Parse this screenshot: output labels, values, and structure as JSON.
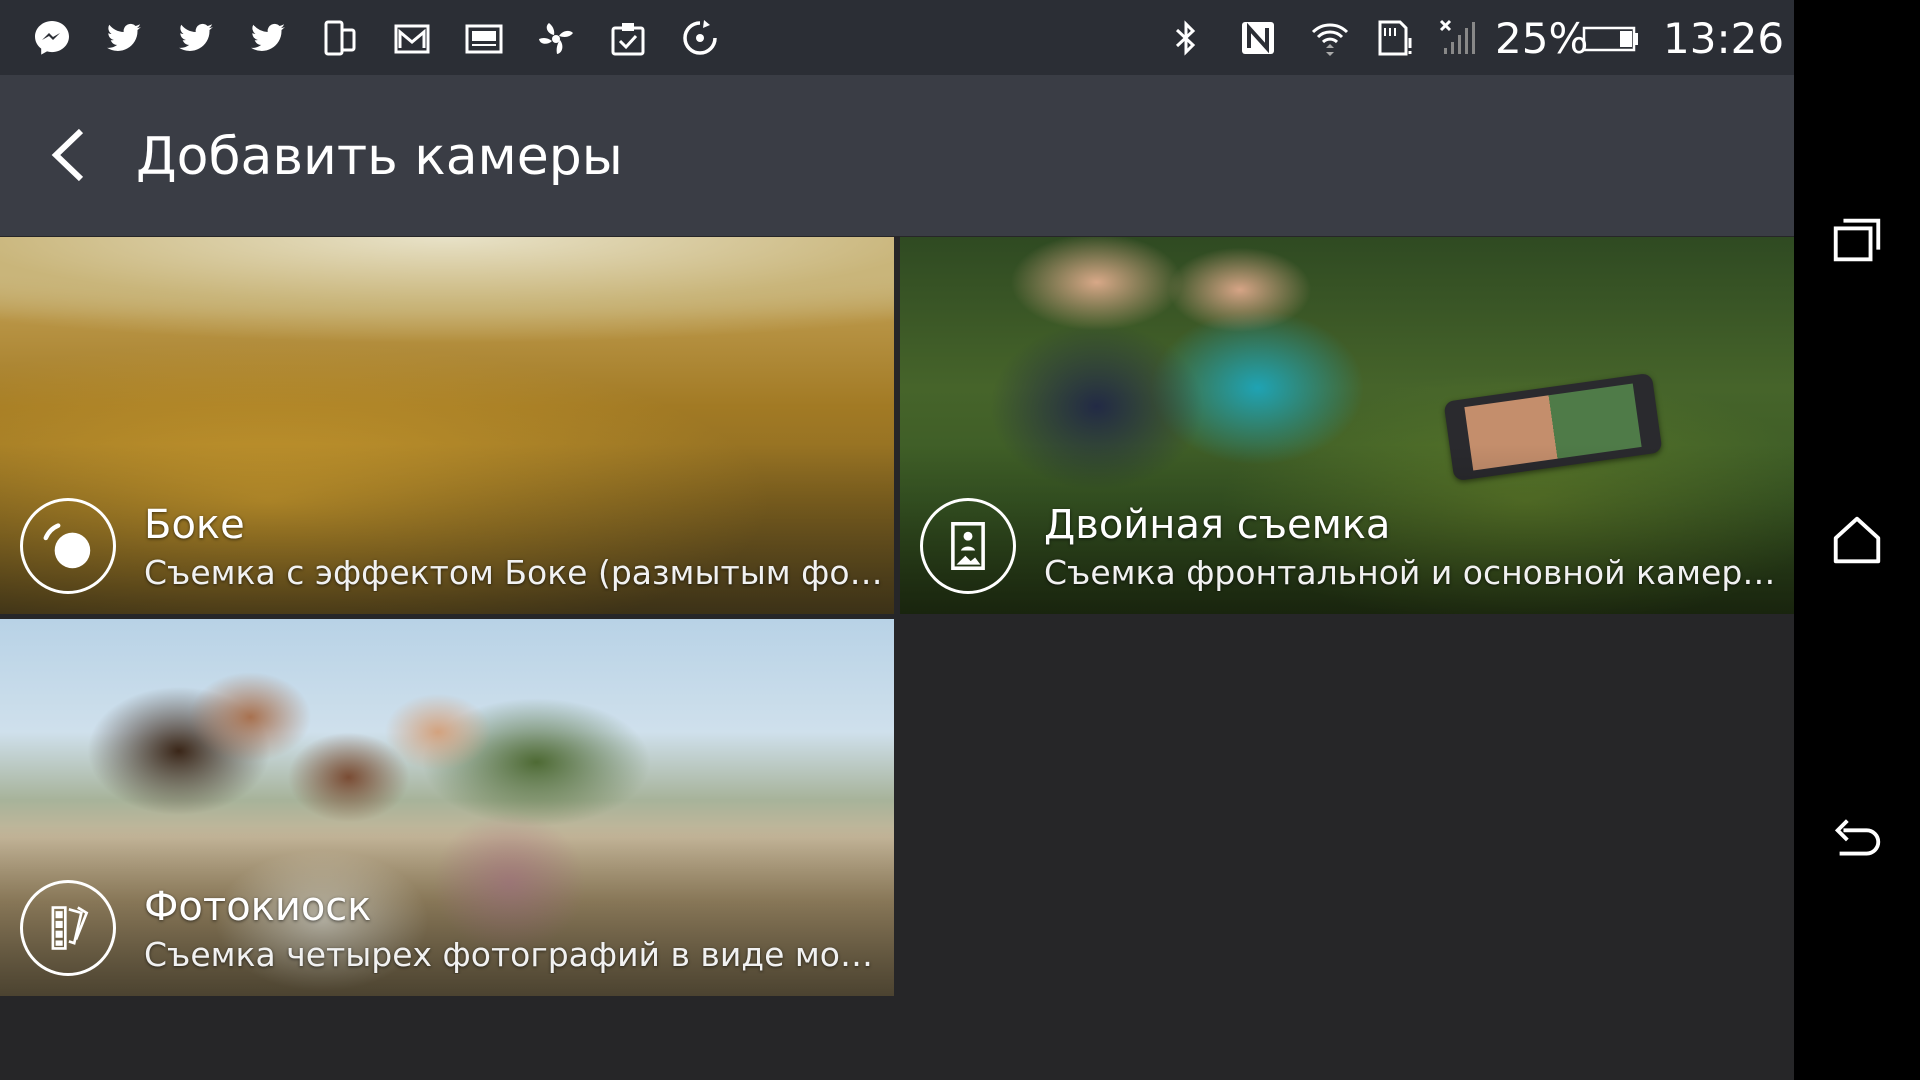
{
  "status_bar": {
    "notification_icons": [
      "messenger-icon",
      "twitter-icon",
      "twitter-icon",
      "twitter-icon",
      "dual-screen-icon",
      "mail-icon",
      "image-icon",
      "fan-icon",
      "clipboard-check-icon",
      "sync-icon"
    ],
    "battery": "25%",
    "time": "13:26"
  },
  "header": {
    "title": "Добавить камеры"
  },
  "cards": [
    {
      "title": "Боке",
      "subtitle": "Съемка с эффектом Боке (размытым фоно...",
      "icon": "bokeh-icon"
    },
    {
      "title": "Двойная съемка",
      "subtitle": "Съемка фронтальной и основной камерами.",
      "icon": "dual-capture-icon"
    },
    {
      "title": "Фотокиоск",
      "subtitle": "Съемка четырех фотографий в виде мозаи...",
      "icon": "photo-booth-icon"
    }
  ],
  "colors": {
    "status_bar_bg": "#2b2e35",
    "action_bar_bg": "#3a3d45",
    "content_bg": "#262628",
    "nav_bar_bg": "#000000"
  }
}
